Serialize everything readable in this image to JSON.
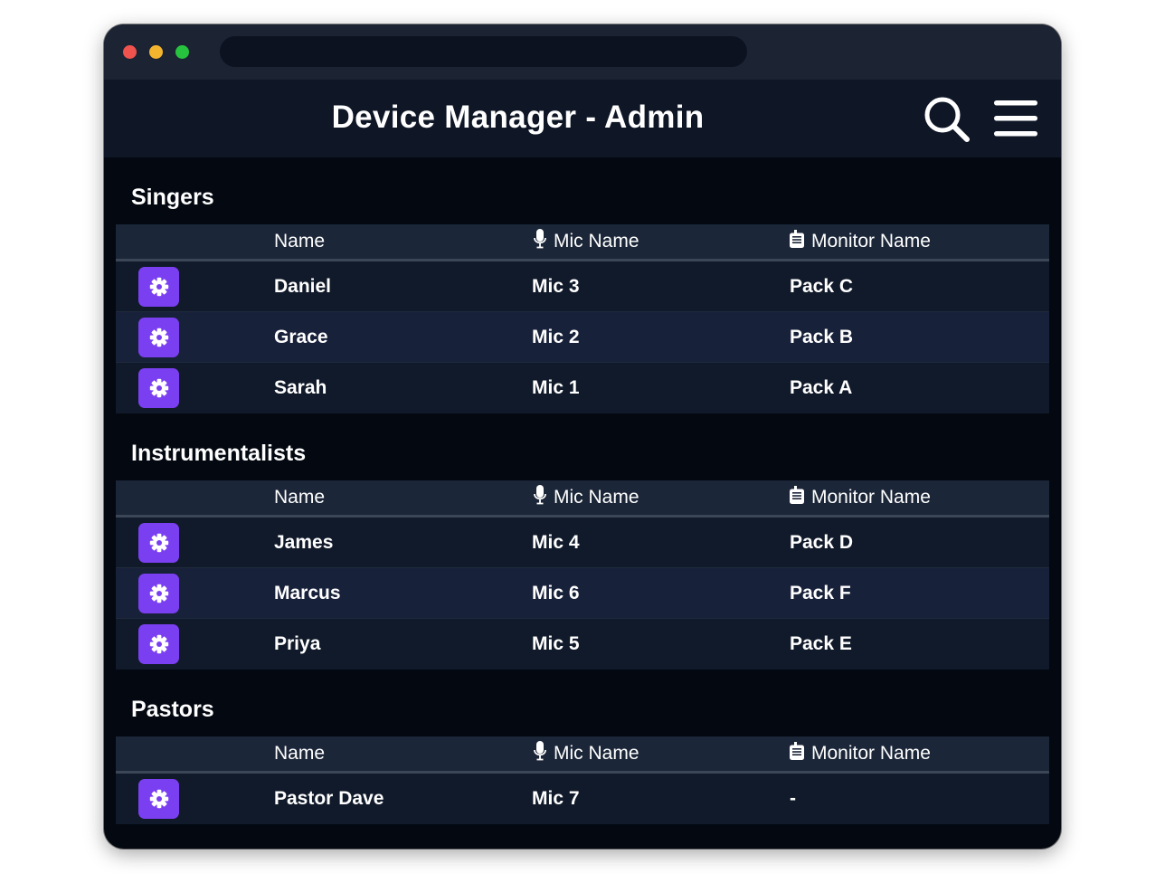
{
  "app": {
    "title": "Device Manager - Admin",
    "accent_color": "#7b3ff2",
    "icons": {
      "search": "search-icon",
      "menu": "hamburger-menu-icon",
      "settings": "gear-icon",
      "mic": "microphone-icon",
      "monitor": "monitor-pack-icon"
    }
  },
  "columns": {
    "name": "Name",
    "mic": "Mic Name",
    "monitor": "Monitor Name"
  },
  "sections": [
    {
      "title": "Singers",
      "rows": [
        {
          "name": "Daniel",
          "mic": "Mic 3",
          "monitor": "Pack C"
        },
        {
          "name": "Grace",
          "mic": "Mic 2",
          "monitor": "Pack B"
        },
        {
          "name": "Sarah",
          "mic": "Mic 1",
          "monitor": "Pack A"
        }
      ]
    },
    {
      "title": "Instrumentalists",
      "rows": [
        {
          "name": "James",
          "mic": "Mic 4",
          "monitor": "Pack D"
        },
        {
          "name": "Marcus",
          "mic": "Mic 6",
          "monitor": "Pack F"
        },
        {
          "name": "Priya",
          "mic": "Mic 5",
          "monitor": "Pack E"
        }
      ]
    },
    {
      "title": "Pastors",
      "rows": [
        {
          "name": "Pastor Dave",
          "mic": "Mic 7",
          "monitor": "-"
        }
      ]
    }
  ]
}
